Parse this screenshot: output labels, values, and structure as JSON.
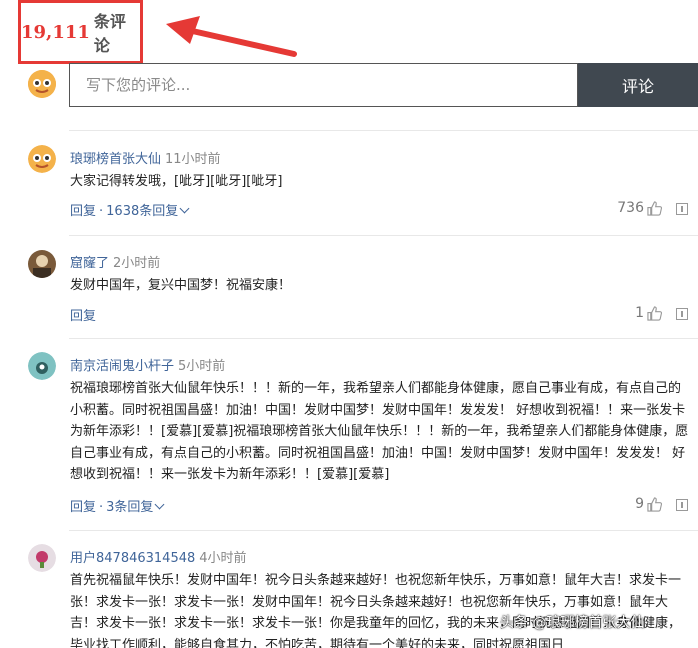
{
  "header": {
    "count": "19,111",
    "count_label": "条评论"
  },
  "composer": {
    "placeholder": "写下您的评论...",
    "submit_label": "评论"
  },
  "comments": [
    {
      "user": "琅琊榜首张大仙",
      "time": "11小时前",
      "text": "大家记得转发哦，[呲牙][呲牙][呲牙]",
      "reply_label": "回复",
      "replies_label": "1638条回复",
      "likes": "736"
    },
    {
      "user": "窟窿了",
      "time": "2小时前",
      "text": "发财中国年，复兴中国梦！祝福安康！",
      "reply_label": "回复",
      "replies_label": "",
      "likes": "1"
    },
    {
      "user": "南京活闹鬼小杆子",
      "time": "5小时前",
      "text": "祝福琅琊榜首张大仙鼠年快乐！！！新的一年，我希望亲人们都能身体健康，愿自己事业有成，有点自己的小积蓄。同时祝祖国昌盛！加油！中国！发财中国梦！发财中国年！发发发！ 好想收到祝福！！来一张发卡为新年添彩！！[爱慕][爱慕]祝福琅琊榜首张大仙鼠年快乐！！！新的一年，我希望亲人们都能身体健康，愿自己事业有成，有点自己的小积蓄。同时祝祖国昌盛！加油！中国！发财中国梦！发财中国年！发发发！ 好想收到祝福！！来一张发卡为新年添彩！！[爱慕][爱慕]",
      "reply_label": "回复",
      "replies_label": "3条回复",
      "likes": "9"
    },
    {
      "user": "用户847846314548",
      "time": "4小时前",
      "text": "首先祝福鼠年快乐！发财中国年！祝今日头条越来越好！也祝您新年快乐，万事如意！鼠年大吉！求发卡一张！求发卡一张！求发卡一张！发财中国年！祝今日头条越来越好！也祝您新年快乐，万事如意！鼠年大吉！求发卡一张！求发卡一张！求发卡一张！你是我童年的回忆，我的未来，同时祝愿祖国日人身体健康，毕业找工作顺利，能够自食其力，不怕吃苦，期待有一个美好的未来，同时祝愿祖国日",
      "reply_label": "",
      "replies_label": "",
      "likes": ""
    }
  ],
  "watermark": "头条 @琅琊榜首张大仙",
  "colors": {
    "accent_red": "#e53935",
    "link_blue": "#406599",
    "button_dark": "#404850"
  }
}
